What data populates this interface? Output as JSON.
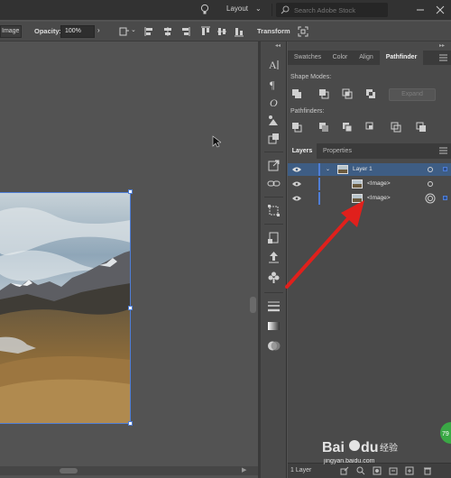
{
  "appbar": {
    "workspace_label": "Layout",
    "search_placeholder": "Search Adobe Stock"
  },
  "control_bar": {
    "image_button": "Image",
    "opacity_label": "Opacity:",
    "opacity_value": "100%",
    "transform_label": "Transform"
  },
  "top_panel": {
    "tabs": [
      "Swatches",
      "Color",
      "Align",
      "Pathfinder"
    ],
    "active_tab": "Pathfinder",
    "shape_modes_label": "Shape Modes:",
    "pathfinders_label": "Pathfinders:",
    "expand_button": "Expand"
  },
  "layers_panel": {
    "tabs": [
      "Layers",
      "Properties"
    ],
    "active_tab": "Layers",
    "rows": [
      {
        "name": "Layer 1",
        "type": "layer",
        "selected": true
      },
      {
        "name": "<Image>",
        "type": "item",
        "selected": false
      },
      {
        "name": "<Image>",
        "type": "item",
        "selected": false
      }
    ],
    "footer_count": "1 Layer"
  },
  "colors": {
    "accent": "#4f7ed6",
    "annotation_arrow": "#e0201c",
    "selected_row": "#3e5d84"
  },
  "icons": [
    "lightbulb-icon",
    "search-icon",
    "minimize-icon",
    "close-icon",
    "eye-icon",
    "menu-icon"
  ],
  "watermark": {
    "logo_text": "Bai du 经验",
    "url_text": "jingyan.baidu.com",
    "badge_text": "79"
  }
}
